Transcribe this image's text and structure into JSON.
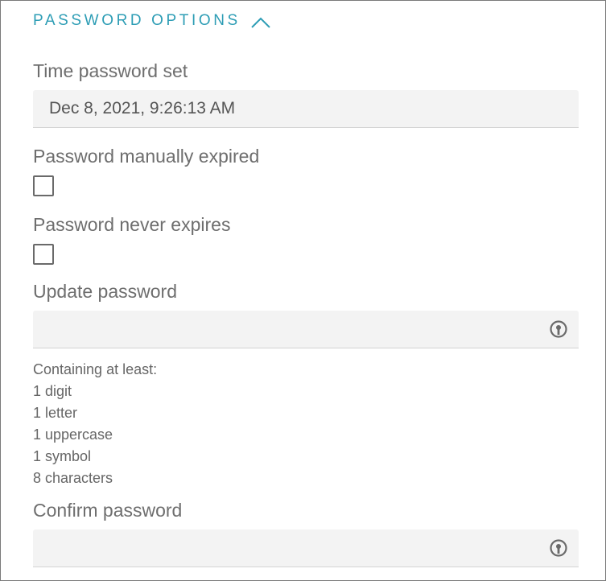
{
  "section": {
    "title": "PASSWORD OPTIONS",
    "toggle_icon": "chevron-up-icon"
  },
  "time_password_set": {
    "label": "Time password set",
    "value": "Dec 8, 2021, 9:26:13 AM"
  },
  "manually_expired": {
    "label": "Password manually expired",
    "checked": false
  },
  "never_expires": {
    "label": "Password never expires",
    "checked": false
  },
  "update_password": {
    "label": "Update password",
    "value": "",
    "icon": "reveal-password-icon"
  },
  "requirements": {
    "heading": "Containing at least:",
    "items": [
      "1 digit",
      "1 letter",
      "1 uppercase",
      "1 symbol",
      "8 characters"
    ]
  },
  "confirm_password": {
    "label": "Confirm password",
    "value": "",
    "icon": "reveal-password-icon"
  },
  "colors": {
    "accent": "#2d9db5",
    "label": "#6e6e6e",
    "field_bg": "#f3f3f3"
  }
}
